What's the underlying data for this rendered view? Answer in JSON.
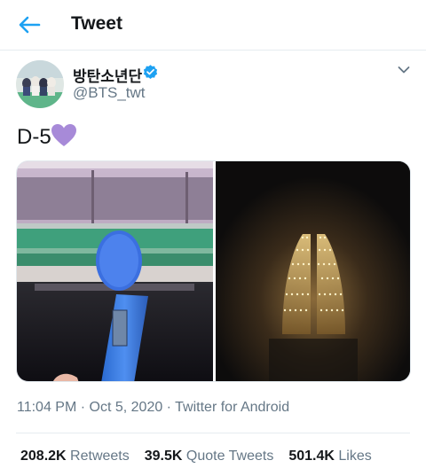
{
  "header": {
    "title": "Tweet",
    "back_icon": "arrow-left-icon"
  },
  "author": {
    "name": "방탄소년단",
    "handle": "@BTS_twt",
    "verified_icon": "verified-badge-icon",
    "more_icon": "chevron-down-icon"
  },
  "tweet": {
    "text": "D-5",
    "emoji": "purple-heart-icon",
    "timestamp": "11:04 PM · Oct 5, 2020 · Twitter for Android"
  },
  "stats": {
    "retweets_count": "208.2K",
    "retweets_label": "Retweets",
    "quotes_count": "39.5K",
    "quotes_label": "Quote Tweets",
    "likes_count": "501.4K",
    "likes_label": "Likes"
  },
  "colors": {
    "accent": "#1da1f2",
    "heart": "#a78ad8",
    "secondary_text": "#657786"
  }
}
